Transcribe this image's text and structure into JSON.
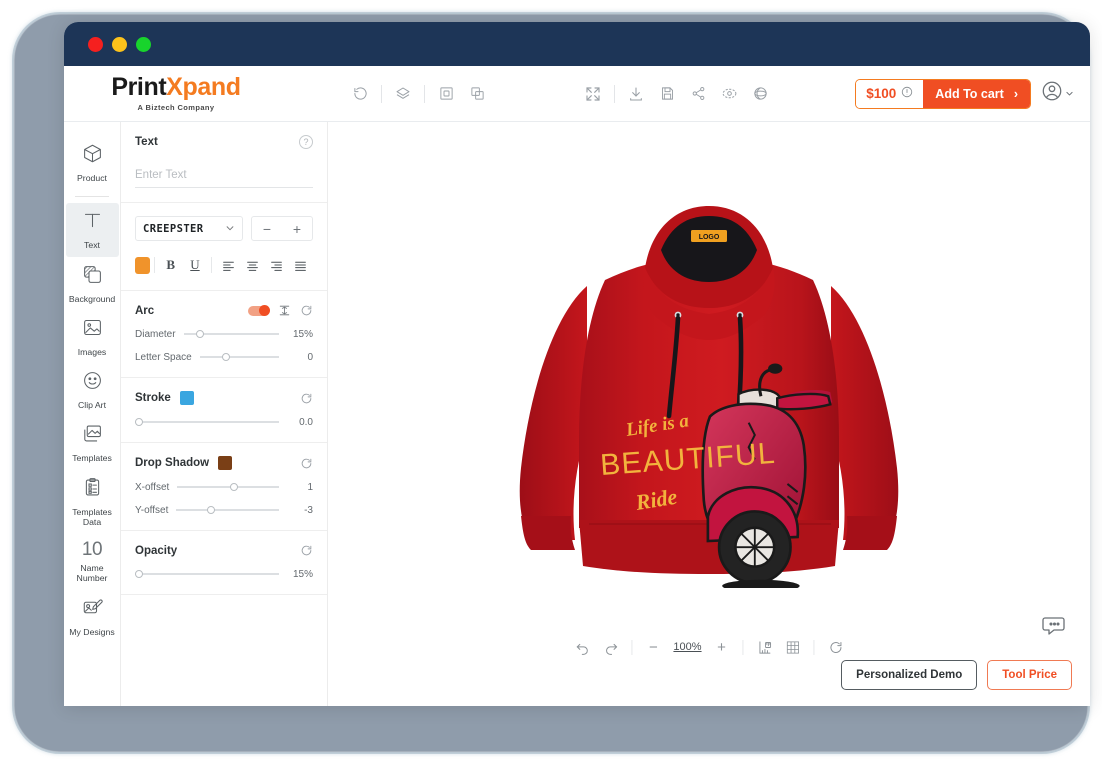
{
  "window": {
    "traffic_lights": [
      "close",
      "minimize",
      "maximize"
    ]
  },
  "header": {
    "logo_print": "Print",
    "logo_x": "X",
    "logo_pand": "pand",
    "logo_tagline": "A Biztech Company",
    "left_tools": [
      {
        "name": "reset-icon",
        "label": "Reset"
      },
      {
        "name": "layers-icon",
        "label": "Layers"
      },
      {
        "name": "duplicate-icon",
        "label": "Duplicate"
      },
      {
        "name": "group-icon",
        "label": "Group"
      }
    ],
    "mid_tools": [
      {
        "name": "fullscreen-icon",
        "label": "Fullscreen"
      },
      {
        "name": "download-icon",
        "label": "Download"
      },
      {
        "name": "save-icon",
        "label": "Save"
      },
      {
        "name": "share-icon",
        "label": "Share"
      },
      {
        "name": "preview-eye-icon",
        "label": "Preview"
      },
      {
        "name": "three-d-view-icon",
        "label": "3D View"
      }
    ],
    "price": "$100",
    "price_info_icon": "info-icon",
    "add_to_cart": "Add To cart",
    "add_to_cart_chevron": "›",
    "account_icon": "user-account-icon",
    "account_chevron": "⌄"
  },
  "sidebar": {
    "items": [
      {
        "label": "Product",
        "icon": "cube-icon",
        "active": false
      },
      {
        "label": "Text",
        "icon": "text-t-icon",
        "active": true
      },
      {
        "label": "Background",
        "icon": "background-squares-icon",
        "active": false
      },
      {
        "label": "Images",
        "icon": "image-icon",
        "active": false
      },
      {
        "label": "Clip Art",
        "icon": "smiley-icon",
        "active": false
      },
      {
        "label": "Templates",
        "icon": "templates-icon",
        "active": false
      },
      {
        "label": "Templates Data",
        "icon": "clipboard-list-icon",
        "active": false
      },
      {
        "label": "Name Number",
        "icon": "number-ten-icon",
        "icon_text": "10",
        "active": false
      },
      {
        "label": "My Designs",
        "icon": "my-designs-icon",
        "active": false
      }
    ]
  },
  "panel": {
    "text_section": {
      "title": "Text",
      "help_icon": "question-mark-icon",
      "input_placeholder": "Enter Text",
      "input_value": ""
    },
    "font": {
      "selected": "CREEPSTER",
      "dropdown_icon": "chevron-down-icon",
      "decrease": "−",
      "increase": "+"
    },
    "style": {
      "color_swatch": "#f0932b",
      "bold": "B",
      "underline": "U",
      "align_options": [
        "align-left",
        "align-center",
        "align-right",
        "align-justify"
      ]
    },
    "arc": {
      "title": "Arc",
      "toggle_on": true,
      "flip_icon": "flip-text-icon",
      "reset_icon": "reset-circle-icon",
      "diameter_label": "Diameter",
      "diameter_value": "15%",
      "diameter_pct": 13,
      "letter_space_label": "Letter Space",
      "letter_space_value": "0",
      "letter_space_pct": 28
    },
    "stroke": {
      "title": "Stroke",
      "swatch": "#3aa6e0",
      "reset_icon": "reset-circle-icon",
      "value": "0.0",
      "pct": 0
    },
    "drop_shadow": {
      "title": "Drop Shadow",
      "swatch": "#7a3f16",
      "reset_icon": "reset-circle-icon",
      "x_label": "X-offset",
      "x_value": "1",
      "x_pct": 52,
      "y_label": "Y-offset",
      "y_value": "-3",
      "y_pct": 30
    },
    "opacity": {
      "title": "Opacity",
      "reset_icon": "reset-circle-icon",
      "value": "15%",
      "pct": 0
    }
  },
  "canvas": {
    "product": "red-hoodie",
    "product_color": "#c4161c",
    "design_text_line1": "Life is a",
    "design_text_line2": "BEAUTIFUL",
    "design_text_line3": "Ride",
    "design_text_color": "#f2b33d",
    "design_graphic": "scooter-illustration",
    "bottom_bar": {
      "undo_icon": "undo-icon",
      "redo_icon": "redo-icon",
      "zoom_out": "−",
      "zoom_value": "100%",
      "zoom_in": "+",
      "ruler_icon": "ruler-icon",
      "grid_icon": "grid-icon",
      "reset_icon": "reset-circle-icon"
    },
    "chat_icon": "chat-bubble-icon",
    "personalized_demo": "Personalized Demo",
    "tool_price": "Tool Price"
  }
}
